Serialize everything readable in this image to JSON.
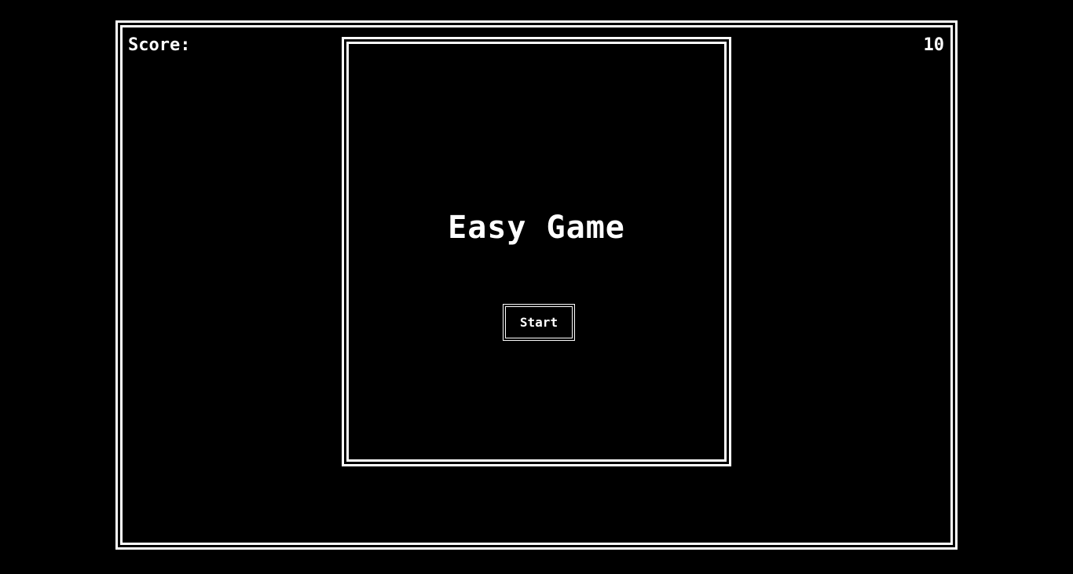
{
  "hud": {
    "score_label": "Score:",
    "score_value": "10"
  },
  "menu": {
    "title": "Easy Game",
    "start_label": "Start"
  },
  "colors": {
    "background": "#000000",
    "foreground": "#ffffff"
  }
}
